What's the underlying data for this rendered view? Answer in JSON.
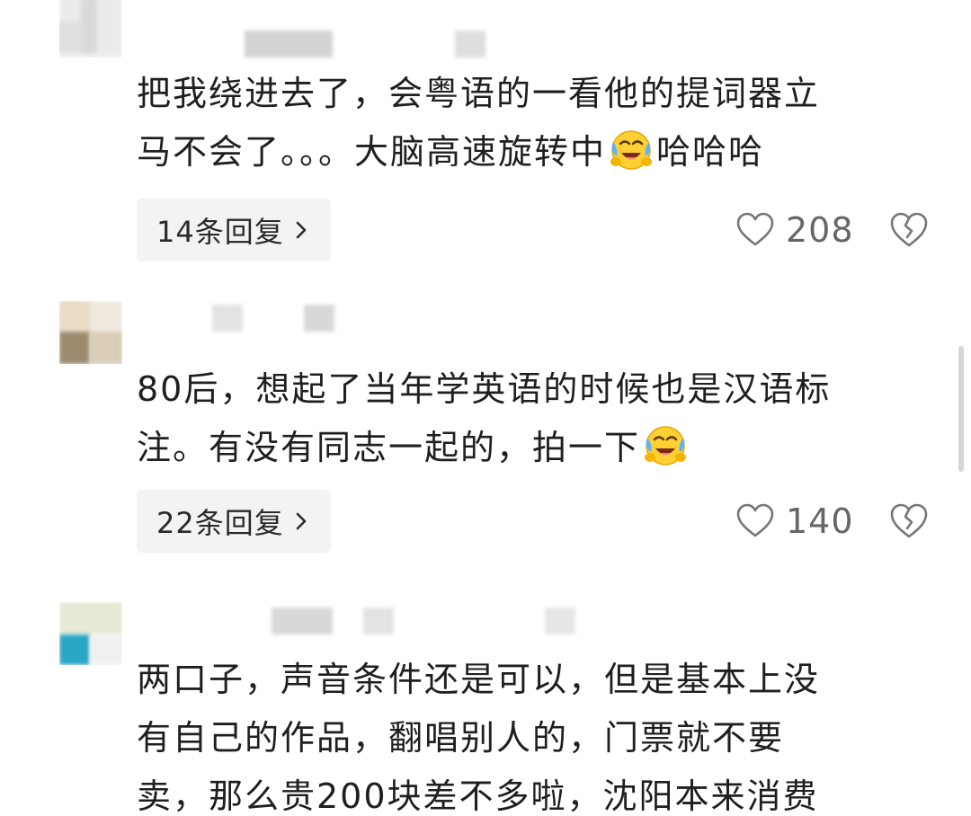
{
  "comments": [
    {
      "text_lines": [
        "把我绕进去了，会粤语的一看他的提词器立",
        "马不会了。。。大脑高速旋转中",
        "哈哈哈"
      ],
      "replies_label": "14条回复",
      "likes": "208",
      "emoji": "laughing-crying-emoji"
    },
    {
      "text_lines": [
        "80后，想起了当年学英语的时候也是汉语标",
        "注。有没有同志一起的，拍一下"
      ],
      "replies_label": "22条回复",
      "likes": "140",
      "emoji": "laughing-crying-emoji"
    },
    {
      "text_lines": [
        "两口子，声音条件还是可以，但是基本上没",
        "有自己的作品，翻唱别人的，门票就不要",
        "卖，那么贵200块差不多啦，沈阳本来消费"
      ]
    }
  ],
  "icons": {
    "like": "heart-outline-icon",
    "dislike": "broken-heart-icon",
    "reply_chevron": "chevron-right-icon"
  },
  "colors": {
    "text": "#1f1f1f",
    "count": "#666666",
    "pill_bg": "#f3f3f3",
    "icon": "#777777"
  }
}
